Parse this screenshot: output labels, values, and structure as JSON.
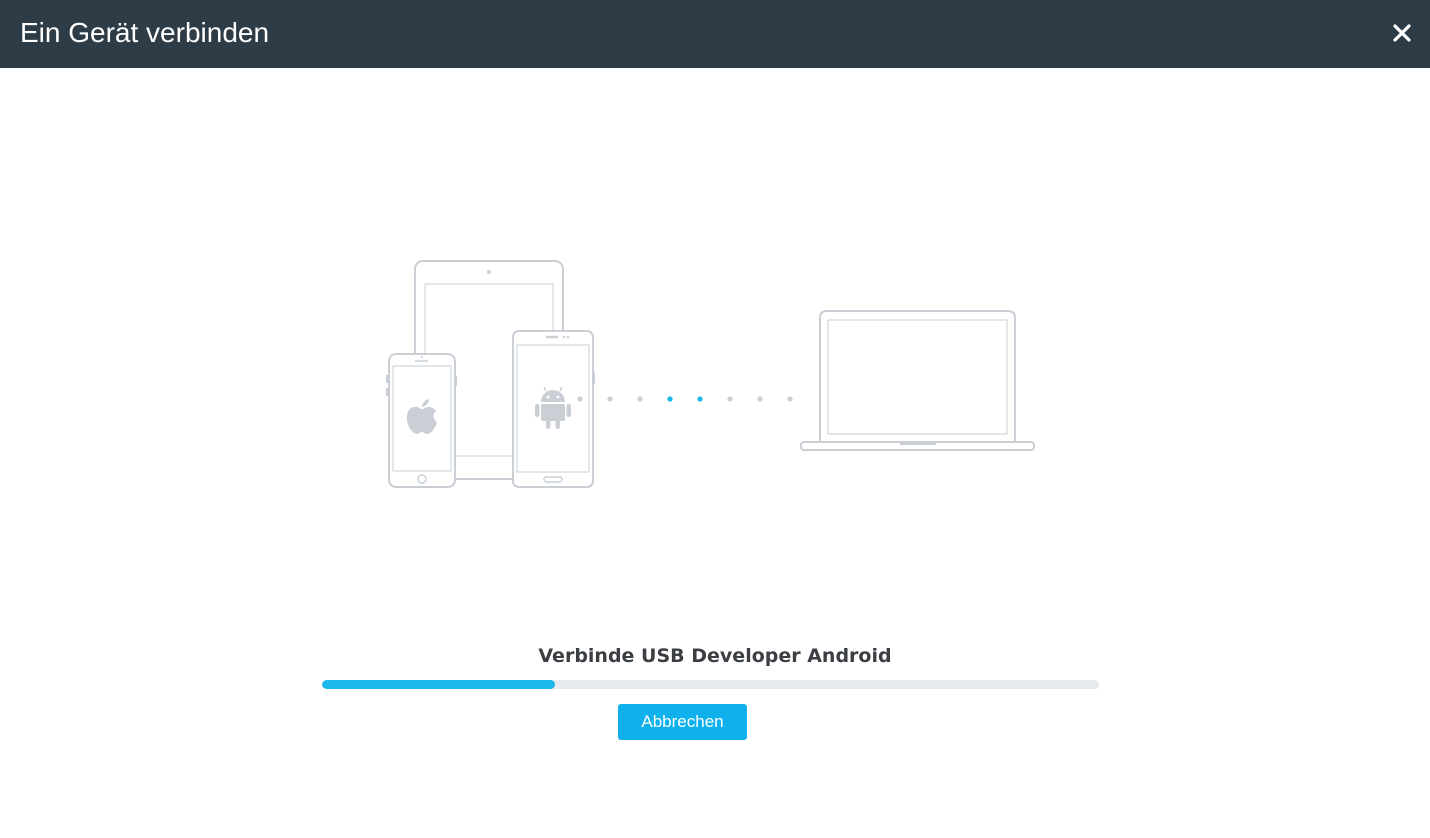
{
  "window": {
    "title": "Ein Gerät verbinden",
    "close_icon": "close-icon"
  },
  "illustration": {
    "devices": [
      "ipad-icon",
      "iphone-icon",
      "android-phone-icon",
      "laptop-icon"
    ],
    "logos": [
      "apple-logo-icon",
      "android-logo-icon"
    ],
    "connection_dots": 8,
    "active_dots": [
      3,
      4
    ]
  },
  "progress": {
    "status_text": "Verbinde USB Developer Android",
    "fraction": 0.3
  },
  "actions": {
    "cancel_label": "Abbrechen"
  },
  "colors": {
    "titlebar": "#2e3c48",
    "accent": "#1ab8ec",
    "device_outline": "#c9cfd5",
    "track": "#e6ebef"
  }
}
